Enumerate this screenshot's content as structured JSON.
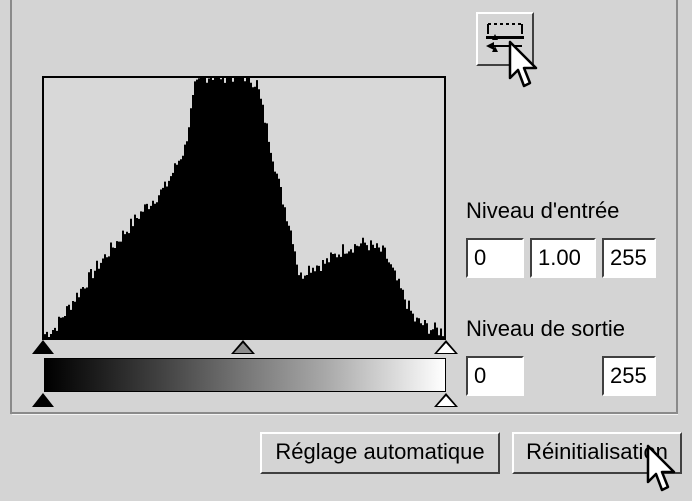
{
  "histogram_button": {
    "icon": "histogram-toggle-icon"
  },
  "histogram": {
    "input_markers": {
      "shadow": 0,
      "midtone": 1.0,
      "highlight": 255
    },
    "output_markers": {
      "shadow": 0,
      "highlight": 255
    }
  },
  "input_level": {
    "label": "Niveau d'entrée",
    "shadow": "0",
    "gamma": "1.00",
    "highlight": "255"
  },
  "output_level": {
    "label": "Niveau de sortie",
    "shadow": "0",
    "highlight": "255"
  },
  "buttons": {
    "auto": "Réglage automatique",
    "reset": "Réinitialisation"
  },
  "colors": {
    "background": "#d4d4d4",
    "histogram_fill": "#000000"
  }
}
